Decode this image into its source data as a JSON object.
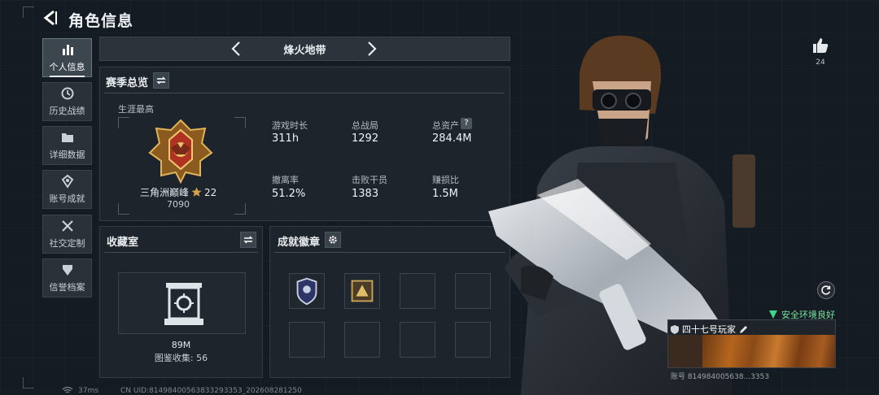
{
  "header": {
    "title": "角色信息"
  },
  "sidebar": {
    "items": [
      {
        "label": "个人信息",
        "icon": "bar-chart-icon",
        "active": true
      },
      {
        "label": "历史战绩",
        "icon": "history-icon",
        "active": false
      },
      {
        "label": "详细数据",
        "icon": "folder-icon",
        "active": false
      },
      {
        "label": "账号成就",
        "icon": "achievement-icon",
        "active": false
      },
      {
        "label": "社交定制",
        "icon": "tools-icon",
        "active": false
      },
      {
        "label": "信誉档案",
        "icon": "credit-icon",
        "active": false
      }
    ]
  },
  "mode": {
    "name": "烽火地带"
  },
  "season": {
    "title": "赛季总览",
    "career_label": "生涯最高",
    "rank_name": "三角洲巅峰",
    "rank_stars": "22",
    "rank_points": "7090",
    "stats": [
      {
        "label": "游戏时长",
        "value": "311h"
      },
      {
        "label": "总战局",
        "value": "1292"
      },
      {
        "label": "总资产",
        "value": "284.4M",
        "help": "?"
      },
      {
        "label": "撤离率",
        "value": "51.2%"
      },
      {
        "label": "击败干员",
        "value": "1383"
      },
      {
        "label": "赚损比",
        "value": "1.5M"
      }
    ]
  },
  "collection": {
    "title": "收藏室",
    "value": "89M",
    "catalog_label": "图鉴收集: 56"
  },
  "badges": {
    "title": "成就徽章"
  },
  "player": {
    "likes": "24",
    "safety_status": "安全环境良好",
    "name": "四十七号玩家",
    "uid_card": "账号 814984005638...3353"
  },
  "footer": {
    "ping": "37ms",
    "uid": "CN UID:8149840056383329335​3_20260828125​0"
  },
  "colors": {
    "accent_green": "#7be5a2",
    "gold": "#d4a24c"
  }
}
